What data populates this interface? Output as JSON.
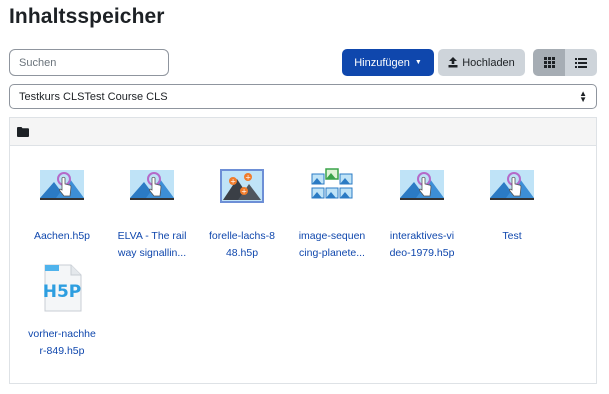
{
  "page": {
    "title": "Inhaltsspeicher"
  },
  "toolbar": {
    "search_placeholder": "Suchen",
    "add_label": "Hinzufügen",
    "upload_label": "Hochladen",
    "view_grid": "grid-icon",
    "view_list": "list-icon"
  },
  "context": {
    "selected": "Testkurs CLSTest Course CLS"
  },
  "breadcrumb": {
    "icon": "folder-icon"
  },
  "files": [
    {
      "line1": "Aachen.h5p",
      "line2": "",
      "icon": "interactive-image-icon"
    },
    {
      "line1": "ELVA - The rail",
      "line2": "way signallin...",
      "icon": "interactive-image-icon"
    },
    {
      "line1": "forelle-lachs-8",
      "line2": "48.h5p",
      "icon": "image-hotspot-icon"
    },
    {
      "line1": "image-sequen",
      "line2": "cing-planete...",
      "icon": "image-sequencing-icon"
    },
    {
      "line1": "interaktives-vi",
      "line2": "deo-1979.h5p",
      "icon": "interactive-image-icon"
    },
    {
      "line1": "Test",
      "line2": "",
      "icon": "interactive-image-icon"
    },
    {
      "line1": "vorher-nachhe",
      "line2": "r-849.h5p",
      "icon": "h5p-file-icon"
    }
  ],
  "colors": {
    "primary": "#0f47ad",
    "secondary": "#ced4da",
    "border": "#dee2e6"
  }
}
